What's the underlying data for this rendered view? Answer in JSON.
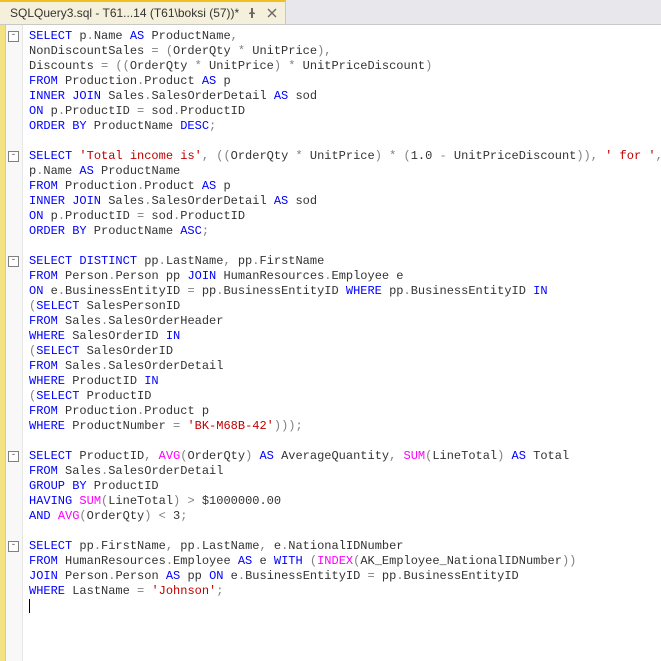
{
  "tab": {
    "title": "SQLQuery3.sql - T61...14 (T61\\boksi (57))*"
  },
  "code": {
    "blocks": [
      {
        "lines": [
          [
            [
              "kw",
              "SELECT"
            ],
            [
              "",
              ""
            ],
            [
              "",
              " p"
            ],
            [
              "op",
              "."
            ],
            [
              "",
              "Name "
            ],
            [
              "kw",
              "AS"
            ],
            [
              "",
              " ProductName"
            ],
            [
              "op",
              ","
            ]
          ],
          [
            [
              "",
              "NonDiscountSales "
            ],
            [
              "op",
              "="
            ],
            [
              "",
              " "
            ],
            [
              "op",
              "("
            ],
            [
              "",
              "OrderQty "
            ],
            [
              "op",
              "*"
            ],
            [
              "",
              " UnitPrice"
            ],
            [
              "op",
              ")"
            ],
            [
              "op",
              ","
            ]
          ],
          [
            [
              "",
              "Discounts "
            ],
            [
              "op",
              "="
            ],
            [
              "",
              " "
            ],
            [
              "op",
              "(("
            ],
            [
              "",
              "OrderQty "
            ],
            [
              "op",
              "*"
            ],
            [
              "",
              " UnitPrice"
            ],
            [
              "op",
              ")"
            ],
            [
              "",
              " "
            ],
            [
              "op",
              "*"
            ],
            [
              "",
              " UnitPriceDiscount"
            ],
            [
              "op",
              ")"
            ]
          ],
          [
            [
              "kw",
              "FROM"
            ],
            [
              "",
              " Production"
            ],
            [
              "op",
              "."
            ],
            [
              "",
              "Product "
            ],
            [
              "kw",
              "AS"
            ],
            [
              "",
              " p"
            ]
          ],
          [
            [
              "kw",
              "INNER JOIN"
            ],
            [
              "",
              " Sales"
            ],
            [
              "op",
              "."
            ],
            [
              "",
              "SalesOrderDetail "
            ],
            [
              "kw",
              "AS"
            ],
            [
              "",
              " sod"
            ]
          ],
          [
            [
              "kw",
              "ON"
            ],
            [
              "",
              " p"
            ],
            [
              "op",
              "."
            ],
            [
              "",
              "ProductID "
            ],
            [
              "op",
              "="
            ],
            [
              "",
              " sod"
            ],
            [
              "op",
              "."
            ],
            [
              "",
              "ProductID"
            ]
          ],
          [
            [
              "kw",
              "ORDER BY"
            ],
            [
              "",
              " ProductName "
            ],
            [
              "kw",
              "DESC"
            ],
            [
              "op",
              ";"
            ]
          ]
        ]
      },
      {
        "lines": [
          [
            [
              "kw",
              "SELECT"
            ],
            [
              "",
              " "
            ],
            [
              "str",
              "'Total income is'"
            ],
            [
              "op",
              ","
            ],
            [
              "",
              " "
            ],
            [
              "op",
              "(("
            ],
            [
              "",
              "OrderQty "
            ],
            [
              "op",
              "*"
            ],
            [
              "",
              " UnitPrice"
            ],
            [
              "op",
              ")"
            ],
            [
              "",
              " "
            ],
            [
              "op",
              "*"
            ],
            [
              "",
              " "
            ],
            [
              "op",
              "("
            ],
            [
              "",
              "1.0 "
            ],
            [
              "op",
              "-"
            ],
            [
              "",
              " UnitPriceDiscount"
            ],
            [
              "op",
              "))"
            ],
            [
              "op",
              ","
            ],
            [
              "",
              " "
            ],
            [
              "str",
              "' for '"
            ],
            [
              "op",
              ","
            ]
          ],
          [
            [
              "",
              "p"
            ],
            [
              "op",
              "."
            ],
            [
              "",
              "Name "
            ],
            [
              "kw",
              "AS"
            ],
            [
              "",
              " ProductName"
            ]
          ],
          [
            [
              "kw",
              "FROM"
            ],
            [
              "",
              " Production"
            ],
            [
              "op",
              "."
            ],
            [
              "",
              "Product "
            ],
            [
              "kw",
              "AS"
            ],
            [
              "",
              " p"
            ]
          ],
          [
            [
              "kw",
              "INNER JOIN"
            ],
            [
              "",
              " Sales"
            ],
            [
              "op",
              "."
            ],
            [
              "",
              "SalesOrderDetail "
            ],
            [
              "kw",
              "AS"
            ],
            [
              "",
              " sod"
            ]
          ],
          [
            [
              "kw",
              "ON"
            ],
            [
              "",
              " p"
            ],
            [
              "op",
              "."
            ],
            [
              "",
              "ProductID "
            ],
            [
              "op",
              "="
            ],
            [
              "",
              " sod"
            ],
            [
              "op",
              "."
            ],
            [
              "",
              "ProductID"
            ]
          ],
          [
            [
              "kw",
              "ORDER BY"
            ],
            [
              "",
              " ProductName "
            ],
            [
              "kw",
              "ASC"
            ],
            [
              "op",
              ";"
            ]
          ]
        ]
      },
      {
        "lines": [
          [
            [
              "kw",
              "SELECT"
            ],
            [
              "",
              " "
            ],
            [
              "kw",
              "DISTINCT"
            ],
            [
              "",
              " pp"
            ],
            [
              "op",
              "."
            ],
            [
              "",
              "LastName"
            ],
            [
              "op",
              ","
            ],
            [
              "",
              " pp"
            ],
            [
              "op",
              "."
            ],
            [
              "",
              "FirstName"
            ]
          ],
          [
            [
              "kw",
              "FROM"
            ],
            [
              "",
              " Person"
            ],
            [
              "op",
              "."
            ],
            [
              "",
              "Person pp "
            ],
            [
              "kw",
              "JOIN"
            ],
            [
              "",
              " HumanResources"
            ],
            [
              "op",
              "."
            ],
            [
              "",
              "Employee e"
            ]
          ],
          [
            [
              "kw",
              "ON"
            ],
            [
              "",
              " e"
            ],
            [
              "op",
              "."
            ],
            [
              "",
              "BusinessEntityID "
            ],
            [
              "op",
              "="
            ],
            [
              "",
              " pp"
            ],
            [
              "op",
              "."
            ],
            [
              "",
              "BusinessEntityID "
            ],
            [
              "kw",
              "WHERE"
            ],
            [
              "",
              " pp"
            ],
            [
              "op",
              "."
            ],
            [
              "",
              "BusinessEntityID "
            ],
            [
              "kw",
              "IN"
            ]
          ],
          [
            [
              "op",
              "("
            ],
            [
              "kw",
              "SELECT"
            ],
            [
              "",
              " SalesPersonID"
            ]
          ],
          [
            [
              "kw",
              "FROM"
            ],
            [
              "",
              " Sales"
            ],
            [
              "op",
              "."
            ],
            [
              "",
              "SalesOrderHeader"
            ]
          ],
          [
            [
              "kw",
              "WHERE"
            ],
            [
              "",
              " SalesOrderID "
            ],
            [
              "kw",
              "IN"
            ]
          ],
          [
            [
              "op",
              "("
            ],
            [
              "kw",
              "SELECT"
            ],
            [
              "",
              " SalesOrderID"
            ]
          ],
          [
            [
              "kw",
              "FROM"
            ],
            [
              "",
              " Sales"
            ],
            [
              "op",
              "."
            ],
            [
              "",
              "SalesOrderDetail"
            ]
          ],
          [
            [
              "kw",
              "WHERE"
            ],
            [
              "",
              " ProductID "
            ],
            [
              "kw",
              "IN"
            ]
          ],
          [
            [
              "op",
              "("
            ],
            [
              "kw",
              "SELECT"
            ],
            [
              "",
              " ProductID"
            ]
          ],
          [
            [
              "kw",
              "FROM"
            ],
            [
              "",
              " Production"
            ],
            [
              "op",
              "."
            ],
            [
              "",
              "Product p"
            ]
          ],
          [
            [
              "kw",
              "WHERE"
            ],
            [
              "",
              " ProductNumber "
            ],
            [
              "op",
              "="
            ],
            [
              "",
              " "
            ],
            [
              "str",
              "'BK-M68B-42'"
            ],
            [
              "op",
              ")));"
            ]
          ]
        ]
      },
      {
        "lines": [
          [
            [
              "kw",
              "SELECT"
            ],
            [
              "",
              " ProductID"
            ],
            [
              "op",
              ","
            ],
            [
              "",
              " "
            ],
            [
              "fn",
              "AVG"
            ],
            [
              "op",
              "("
            ],
            [
              "",
              "OrderQty"
            ],
            [
              "op",
              ")"
            ],
            [
              "",
              " "
            ],
            [
              "kw",
              "AS"
            ],
            [
              "",
              " AverageQuantity"
            ],
            [
              "op",
              ","
            ],
            [
              "",
              " "
            ],
            [
              "fn",
              "SUM"
            ],
            [
              "op",
              "("
            ],
            [
              "",
              "LineTotal"
            ],
            [
              "op",
              ")"
            ],
            [
              "",
              " "
            ],
            [
              "kw",
              "AS"
            ],
            [
              "",
              " Total"
            ]
          ],
          [
            [
              "kw",
              "FROM"
            ],
            [
              "",
              " Sales"
            ],
            [
              "op",
              "."
            ],
            [
              "",
              "SalesOrderDetail"
            ]
          ],
          [
            [
              "kw",
              "GROUP BY"
            ],
            [
              "",
              " ProductID"
            ]
          ],
          [
            [
              "kw",
              "HAVING"
            ],
            [
              "",
              " "
            ],
            [
              "fn",
              "SUM"
            ],
            [
              "op",
              "("
            ],
            [
              "",
              "LineTotal"
            ],
            [
              "op",
              ")"
            ],
            [
              "",
              " "
            ],
            [
              "op",
              ">"
            ],
            [
              "",
              " $1000000.00"
            ]
          ],
          [
            [
              "kw",
              "AND"
            ],
            [
              "",
              " "
            ],
            [
              "fn",
              "AVG"
            ],
            [
              "op",
              "("
            ],
            [
              "",
              "OrderQty"
            ],
            [
              "op",
              ")"
            ],
            [
              "",
              " "
            ],
            [
              "op",
              "<"
            ],
            [
              "",
              " 3"
            ],
            [
              "op",
              ";"
            ]
          ]
        ]
      },
      {
        "lines": [
          [
            [
              "kw",
              "SELECT"
            ],
            [
              "",
              " pp"
            ],
            [
              "op",
              "."
            ],
            [
              "",
              "FirstName"
            ],
            [
              "op",
              ","
            ],
            [
              "",
              " pp"
            ],
            [
              "op",
              "."
            ],
            [
              "",
              "LastName"
            ],
            [
              "op",
              ","
            ],
            [
              "",
              " e"
            ],
            [
              "op",
              "."
            ],
            [
              "",
              "NationalIDNumber"
            ]
          ],
          [
            [
              "kw",
              "FROM"
            ],
            [
              "",
              " HumanResources"
            ],
            [
              "op",
              "."
            ],
            [
              "",
              "Employee "
            ],
            [
              "kw",
              "AS"
            ],
            [
              "",
              " e "
            ],
            [
              "kw",
              "WITH"
            ],
            [
              "",
              " "
            ],
            [
              "op",
              "("
            ],
            [
              "fn",
              "INDEX"
            ],
            [
              "op",
              "("
            ],
            [
              "",
              "AK_Employee_NationalIDNumber"
            ],
            [
              "op",
              "))"
            ]
          ],
          [
            [
              "kw",
              "JOIN"
            ],
            [
              "",
              " Person"
            ],
            [
              "op",
              "."
            ],
            [
              "",
              "Person "
            ],
            [
              "kw",
              "AS"
            ],
            [
              "",
              " pp "
            ],
            [
              "kw",
              "ON"
            ],
            [
              "",
              " e"
            ],
            [
              "op",
              "."
            ],
            [
              "",
              "BusinessEntityID "
            ],
            [
              "op",
              "="
            ],
            [
              "",
              " pp"
            ],
            [
              "op",
              "."
            ],
            [
              "",
              "BusinessEntityID"
            ]
          ],
          [
            [
              "kw",
              "WHERE"
            ],
            [
              "",
              " LastName "
            ],
            [
              "op",
              "="
            ],
            [
              "",
              " "
            ],
            [
              "str",
              "'Johnson'"
            ],
            [
              "op",
              ";"
            ]
          ]
        ]
      }
    ]
  }
}
